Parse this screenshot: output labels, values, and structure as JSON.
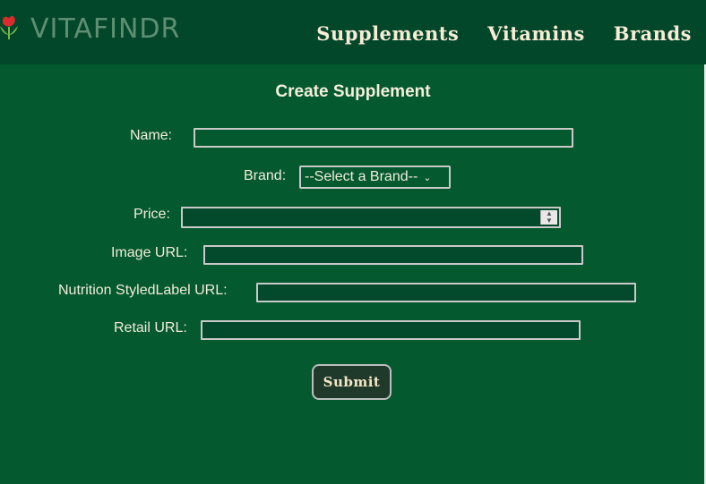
{
  "header": {
    "brand": "VITAFINDR",
    "nav": [
      "Supplements",
      "Vitamins",
      "Brands"
    ]
  },
  "form": {
    "title": "Create Supplement",
    "name_label": "Name:",
    "brand_label": "Brand:",
    "brand_selected": "--Select a Brand--",
    "price_label": "Price:",
    "image_label": "Image URL:",
    "nutrition_label": "Nutrition StyledLabel URL:",
    "retail_label": "Retail URL:",
    "submit_label": "Submit"
  },
  "colors": {
    "background": "#04592e",
    "header": "#03472a",
    "text": "#f3ecd9"
  }
}
